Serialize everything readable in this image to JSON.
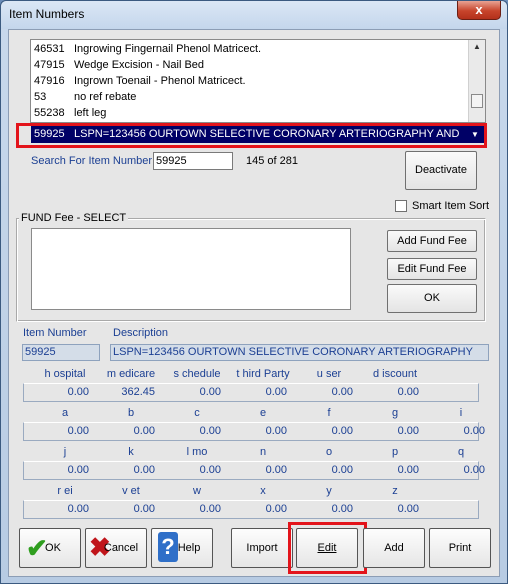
{
  "window": {
    "title": "Item Numbers",
    "close_symbol": "x"
  },
  "list": {
    "rows": [
      {
        "code": "46531",
        "desc": "Ingrowing Fingernail Phenol Matricect."
      },
      {
        "code": "47915",
        "desc": "Wedge Excision - Nail Bed"
      },
      {
        "code": "47916",
        "desc": "Ingrown Toenail - Phenol Matricect."
      },
      {
        "code": "53",
        "desc": "no ref rebate"
      },
      {
        "code": "55238",
        "desc": "left leg"
      }
    ]
  },
  "selected": {
    "code": "59925",
    "desc": "LSPN=123456 OURTOWN SELECTIVE CORONARY ARTERIOGRAPHY AND"
  },
  "search": {
    "label": "Search For Item Number:",
    "value": "59925",
    "count": "145 of 281"
  },
  "buttons": {
    "deactivate": "Deactivate",
    "add_fund_fee": "Add Fund Fee",
    "edit_fund_fee": "Edit Fund Fee",
    "ok_small": "OK",
    "ok": "OK",
    "cancel": "Cancel",
    "help": "Help",
    "import": "Import",
    "edit": "Edit",
    "add": "Add",
    "print": "Print"
  },
  "smart_sort": {
    "label": "Smart Item Sort",
    "checked": false
  },
  "fund_fee": {
    "label": "FUND Fee - SELECT"
  },
  "item": {
    "number_label": "Item Number",
    "description_label": "Description",
    "number": "59925",
    "description": "LSPN=123456 OURTOWN SELECTIVE CORONARY ARTERIOGRAPHY"
  },
  "fees": {
    "row1": [
      {
        "label": "h ospital",
        "value": "0.00"
      },
      {
        "label": "m edicare",
        "value": "362.45"
      },
      {
        "label": "s chedule",
        "value": "0.00"
      },
      {
        "label": "t hird Party",
        "value": "0.00"
      },
      {
        "label": "u ser",
        "value": "0.00"
      },
      {
        "label": "d iscount",
        "value": "0.00"
      }
    ],
    "row2": [
      {
        "label": "a",
        "value": "0.00"
      },
      {
        "label": "b",
        "value": "0.00"
      },
      {
        "label": "c",
        "value": "0.00"
      },
      {
        "label": "e",
        "value": "0.00"
      },
      {
        "label": "f",
        "value": "0.00"
      },
      {
        "label": "g",
        "value": "0.00"
      },
      {
        "label": "i",
        "value": "0.00"
      }
    ],
    "row3": [
      {
        "label": "j",
        "value": "0.00"
      },
      {
        "label": "k",
        "value": "0.00"
      },
      {
        "label": "l mo",
        "value": "0.00"
      },
      {
        "label": "n",
        "value": "0.00"
      },
      {
        "label": "o",
        "value": "0.00"
      },
      {
        "label": "p",
        "value": "0.00"
      },
      {
        "label": "q",
        "value": "0.00"
      }
    ],
    "row4": [
      {
        "label": "r ei",
        "value": "0.00"
      },
      {
        "label": "v et",
        "value": "0.00"
      },
      {
        "label": "w",
        "value": "0.00"
      },
      {
        "label": "x",
        "value": "0.00"
      },
      {
        "label": "y",
        "value": "0.00"
      },
      {
        "label": "z",
        "value": "0.00"
      }
    ]
  },
  "icons": {
    "ok": "check-icon",
    "cancel": "x-icon",
    "help": "question-icon"
  },
  "colors": {
    "highlight": "#e3141b",
    "selection": "#000066",
    "label_blue": "#1b3f93"
  }
}
